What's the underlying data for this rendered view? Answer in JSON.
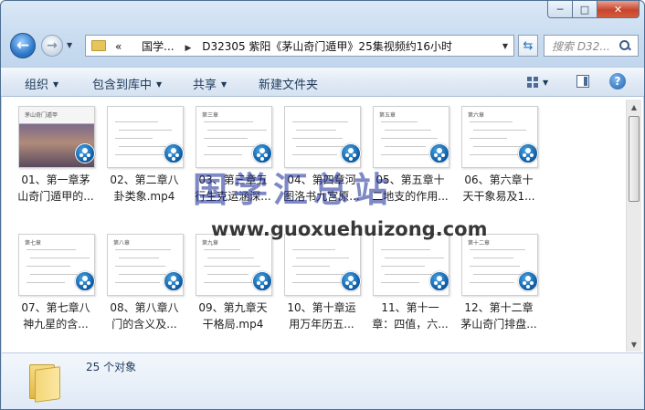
{
  "window": {
    "caption_buttons": {
      "minimize": "─",
      "maximize": "□",
      "close": "✕"
    }
  },
  "nav": {
    "back_glyph": "←",
    "forward_glyph": "→",
    "breadcrumb": [
      "«",
      "国学...",
      "D32305 紫阳《茅山奇门遁甲》25集视频约16小时"
    ],
    "search_placeholder": "搜索 D32...",
    "icons": [
      "folder-icon",
      "refresh-icon",
      "search-icon"
    ]
  },
  "toolbar": {
    "organize": "组织",
    "include_in_library": "包含到库中",
    "share": "共享",
    "new_folder": "新建文件夹",
    "help_glyph": "?"
  },
  "files": [
    {
      "line1": "01、第一章茅",
      "line2": "山奇门遁甲的...",
      "thumb_title": "茅山奇门遁甲"
    },
    {
      "line1": "02、第二章八",
      "line2": "卦类象.mp4",
      "thumb_title": ""
    },
    {
      "line1": "03、第三章五",
      "line2": "行生克运涵深...",
      "thumb_title": "第三章"
    },
    {
      "line1": "04、第四章河",
      "line2": "图洛书九宫原...",
      "thumb_title": ""
    },
    {
      "line1": "05、第五章十",
      "line2": "二地支的作用...",
      "thumb_title": "第五章"
    },
    {
      "line1": "06、第六章十",
      "line2": "天干象易及1...",
      "thumb_title": "第六章"
    },
    {
      "line1": "07、第七章八",
      "line2": "神九星的含...",
      "thumb_title": "第七章"
    },
    {
      "line1": "08、第八章八",
      "line2": "门的含义及...",
      "thumb_title": "第八章"
    },
    {
      "line1": "09、第九章天",
      "line2": "干格局.mp4",
      "thumb_title": "第九章"
    },
    {
      "line1": "10、第十章运",
      "line2": "用万年历五...",
      "thumb_title": ""
    },
    {
      "line1": "11、第十一",
      "line2": "章：四值，六...",
      "thumb_title": ""
    },
    {
      "line1": "12、第十二章",
      "line2": "茅山奇门排盘...",
      "thumb_title": "第十二章"
    }
  ],
  "watermark": {
    "brand": "国学汇总站",
    "url": "www.guoxuehuizong.com"
  },
  "status": {
    "count": "25 个对象"
  }
}
